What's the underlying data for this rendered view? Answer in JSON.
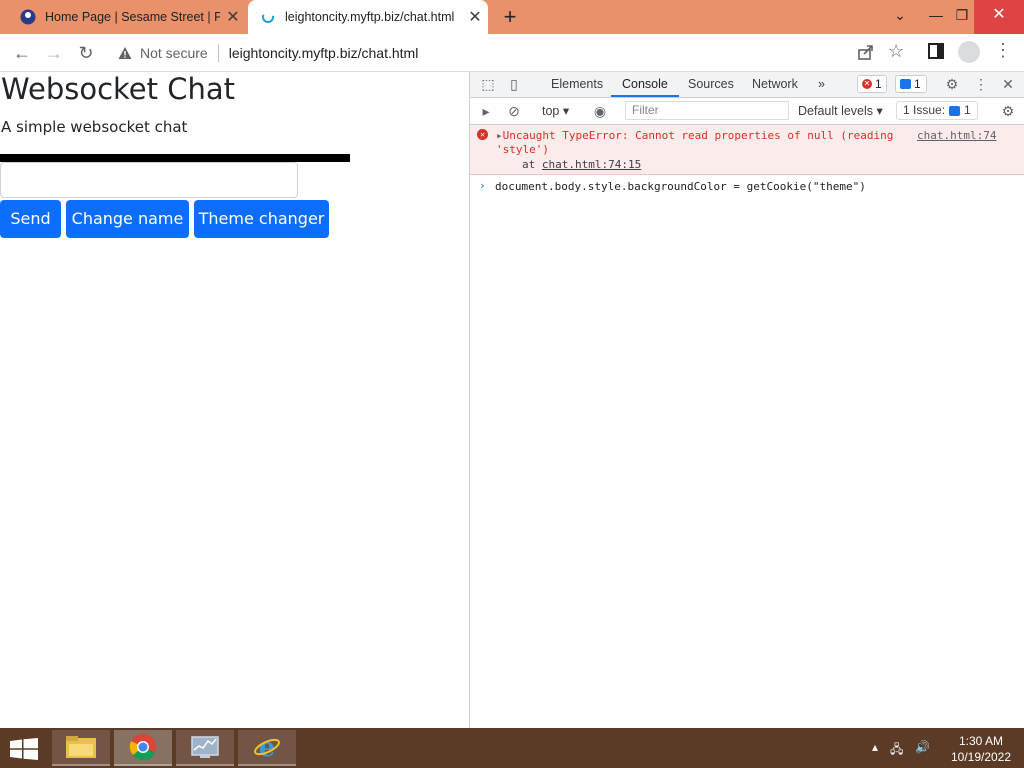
{
  "browser": {
    "tabs": [
      {
        "title": "Home Page | Sesame Street | PBS",
        "active": false
      },
      {
        "title": "leightoncity.myftp.biz/chat.html",
        "active": true
      }
    ],
    "security_label": "Not secure",
    "url": "leightoncity.myftp.biz/chat.html"
  },
  "page": {
    "heading": "Websocket Chat",
    "subtitle": "A simple websocket chat",
    "buttons": {
      "send": "Send",
      "change_name": "Change name",
      "theme": "Theme changer"
    },
    "button_color": "#0d6efd"
  },
  "devtools": {
    "tabs": [
      "Elements",
      "Console",
      "Sources",
      "Network"
    ],
    "more": "»",
    "error_count": "1",
    "message_count": "1",
    "context": "top",
    "filter_placeholder": "Filter",
    "levels": "Default levels ▾",
    "issues": {
      "label": "1 Issue:",
      "count": "1"
    },
    "error": {
      "line1": "Uncaught TypeError: Cannot read properties of null (reading",
      "line2": "'style')",
      "at_prefix": "at",
      "at_link": "chat.html:74:15",
      "source": "chat.html:74"
    },
    "command": "document.body.style.backgroundColor = getCookie(\"theme\")"
  },
  "taskbar": {
    "time": "1:30 AM",
    "date": "10/19/2022"
  }
}
